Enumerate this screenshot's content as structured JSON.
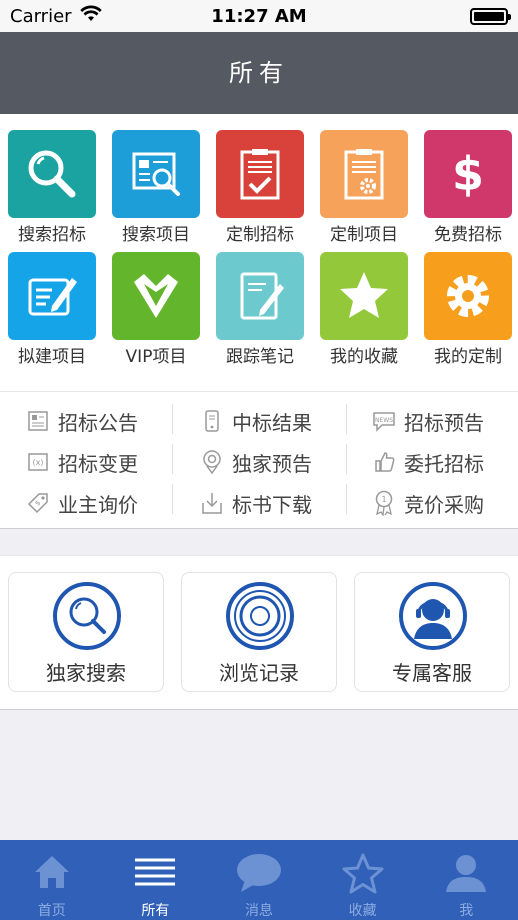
{
  "status": {
    "carrier": "Carrier",
    "time": "11:27 AM"
  },
  "nav": {
    "title": "所有"
  },
  "grid": [
    {
      "label": "搜索招标",
      "color": "#1aa3a0",
      "icon": "search-icon"
    },
    {
      "label": "搜索项目",
      "color": "#1d9ed8",
      "icon": "search-document-icon"
    },
    {
      "label": "定制招标",
      "color": "#d9413b",
      "icon": "clipboard-check-icon"
    },
    {
      "label": "定制项目",
      "color": "#f7a25a",
      "icon": "clipboard-gear-icon"
    },
    {
      "label": "免费招标",
      "color": "#d0376a",
      "icon": "dollar-icon"
    },
    {
      "label": "拟建项目",
      "color": "#16a4e8",
      "icon": "edit-document-icon"
    },
    {
      "label": "VIP项目",
      "color": "#63b52c",
      "icon": "diamond-icon"
    },
    {
      "label": "跟踪笔记",
      "color": "#6cc9ce",
      "icon": "notebook-pen-icon"
    },
    {
      "label": "我的收藏",
      "color": "#93c83b",
      "icon": "star-icon"
    },
    {
      "label": "我的定制",
      "color": "#f79e1d",
      "icon": "gear-icon"
    }
  ],
  "categories": [
    {
      "label": "招标公告",
      "icon": "document-list-icon"
    },
    {
      "label": "中标结果",
      "icon": "phone-doc-icon"
    },
    {
      "label": "招标预告",
      "icon": "news-bubble-icon"
    },
    {
      "label": "招标变更",
      "icon": "variable-doc-icon"
    },
    {
      "label": "独家预告",
      "icon": "location-pin-icon"
    },
    {
      "label": "委托招标",
      "icon": "thumbs-up-icon"
    },
    {
      "label": "业主询价",
      "icon": "price-tag-icon"
    },
    {
      "label": "标书下载",
      "icon": "download-icon"
    },
    {
      "label": "竞价采购",
      "icon": "award-ribbon-icon"
    }
  ],
  "cards": [
    {
      "label": "独家搜索",
      "icon": "search-circle-icon"
    },
    {
      "label": "浏览记录",
      "icon": "history-rings-icon"
    },
    {
      "label": "专属客服",
      "icon": "customer-service-icon"
    }
  ],
  "tabs": [
    {
      "label": "首页",
      "icon": "home-icon"
    },
    {
      "label": "所有",
      "icon": "list-icon"
    },
    {
      "label": "消息",
      "icon": "chat-bubble-icon"
    },
    {
      "label": "收藏",
      "icon": "star-outline-icon"
    },
    {
      "label": "我",
      "icon": "user-icon"
    }
  ],
  "colors": {
    "nav_bg": "#555a62",
    "tab_bg": "#3060b8",
    "accent_blue": "#1f56b0"
  }
}
